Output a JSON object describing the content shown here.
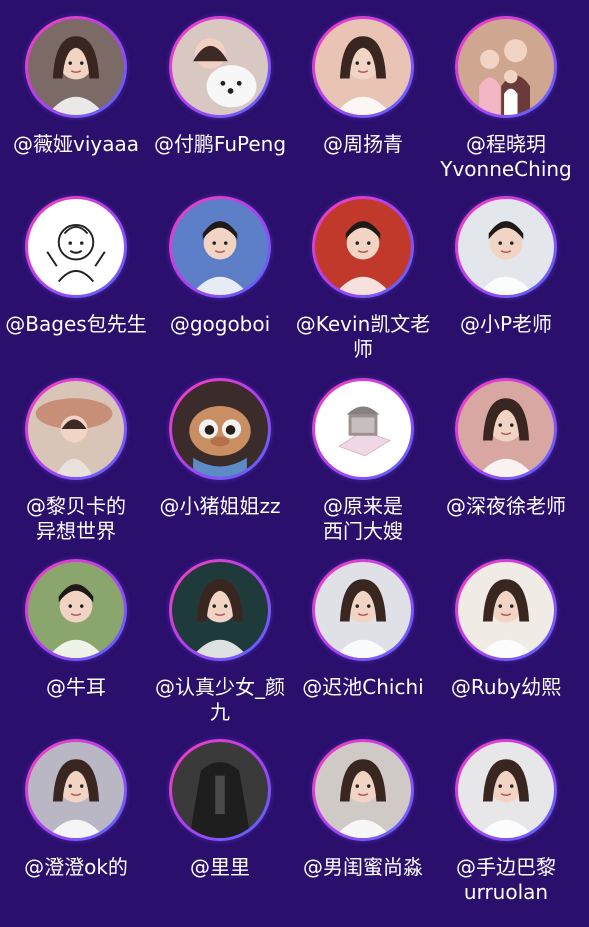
{
  "influencers": [
    {
      "name": "@薇娅viyaaa",
      "avatar_icon": "woman-portrait-icon",
      "tone": "#7b6a66"
    },
    {
      "name": "@付鹏FuPeng",
      "avatar_icon": "man-with-dog-icon",
      "tone": "#d8c9c2"
    },
    {
      "name": "@周扬青",
      "avatar_icon": "woman-portrait-icon",
      "tone": "#e9c3b3"
    },
    {
      "name": "@程晓玥\nYvonneChing",
      "avatar_icon": "family-photo-icon",
      "tone": "#b89a8a"
    },
    {
      "name": "@Bages包先生",
      "avatar_icon": "cartoon-boy-icon",
      "tone": "#ffffff"
    },
    {
      "name": "@gogoboi",
      "avatar_icon": "man-portrait-icon",
      "tone": "#5d7fc8"
    },
    {
      "name": "@Kevin凯文老师",
      "avatar_icon": "man-portrait-icon",
      "tone": "#c0392b"
    },
    {
      "name": "@小P老师",
      "avatar_icon": "man-portrait-icon",
      "tone": "#e3e6ea"
    },
    {
      "name": "@黎贝卡的\n异想世界",
      "avatar_icon": "woman-with-hat-icon",
      "tone": "#c78f77"
    },
    {
      "name": "@小猪姐姐zz",
      "avatar_icon": "cartoon-character-icon",
      "tone": "#6b4d3a"
    },
    {
      "name": "@原来是\n西门大嫂",
      "avatar_icon": "object-logo-icon",
      "tone": "#ffffff"
    },
    {
      "name": "@深夜徐老师",
      "avatar_icon": "woman-portrait-icon",
      "tone": "#d9a7a1"
    },
    {
      "name": "@牛耳",
      "avatar_icon": "man-portrait-icon",
      "tone": "#8aa66d"
    },
    {
      "name": "@认真少女_颜九",
      "avatar_icon": "woman-portrait-icon",
      "tone": "#1f3a3a"
    },
    {
      "name": "@迟池Chichi",
      "avatar_icon": "woman-portrait-icon",
      "tone": "#dfe1e6"
    },
    {
      "name": "@Ruby幼熙",
      "avatar_icon": "woman-portrait-icon",
      "tone": "#f1ebe6"
    },
    {
      "name": "@澄澄ok的",
      "avatar_icon": "woman-portrait-icon",
      "tone": "#b8b7c3"
    },
    {
      "name": "@里里",
      "avatar_icon": "person-back-icon",
      "tone": "#2b2b2b"
    },
    {
      "name": "@男闺蜜尚淼",
      "avatar_icon": "woman-portrait-icon",
      "tone": "#cfcac5"
    },
    {
      "name": "@手边巴黎\nurruolan",
      "avatar_icon": "woman-portrait-icon",
      "tone": "#e7e7ea"
    }
  ],
  "colors": {
    "background": "#2a0f6c",
    "ring_start": "#ff3fb4",
    "ring_end": "#4c6bff",
    "text": "#ffffff"
  }
}
